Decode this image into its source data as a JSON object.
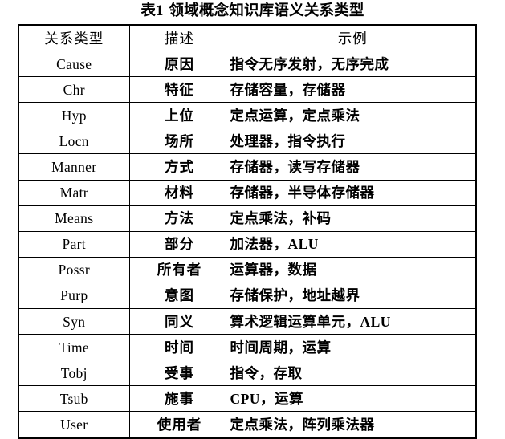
{
  "caption": {
    "label": "表",
    "number": "1",
    "title": "领域概念知识库语义关系类型",
    "full": "表 1  领域概念知识库语义关系类型"
  },
  "table": {
    "columns": [
      {
        "key": "type",
        "header": "关系类型"
      },
      {
        "key": "description",
        "header": "描述"
      },
      {
        "key": "example",
        "header": "示例"
      }
    ],
    "rows": [
      {
        "type": "Cause",
        "description": "原因",
        "example": "指令无序发射，无序完成"
      },
      {
        "type": "Chr",
        "description": "特征",
        "example": "存储容量，存储器"
      },
      {
        "type": "Hyp",
        "description": "上位",
        "example": "定点运算，定点乘法"
      },
      {
        "type": "Locn",
        "description": "场所",
        "example": "处理器，指令执行"
      },
      {
        "type": "Manner",
        "description": "方式",
        "example": "存储器，读写存储器"
      },
      {
        "type": "Matr",
        "description": "材料",
        "example": "存储器，半导体存储器"
      },
      {
        "type": "Means",
        "description": "方法",
        "example": "定点乘法，补码"
      },
      {
        "type": "Part",
        "description": "部分",
        "example": "加法器，ALU"
      },
      {
        "type": "Possr",
        "description": "所有者",
        "example": "运算器，数据"
      },
      {
        "type": "Purp",
        "description": "意图",
        "example": "存储保护，地址越界"
      },
      {
        "type": "Syn",
        "description": "同义",
        "example": "算术逻辑运算单元，ALU"
      },
      {
        "type": "Time",
        "description": "时间",
        "example": "时间周期，运算"
      },
      {
        "type": "Tobj",
        "description": "受事",
        "example": "指令，存取"
      },
      {
        "type": "Tsub",
        "description": "施事",
        "example": "CPU，运算"
      },
      {
        "type": "User",
        "description": "使用者",
        "example": "定点乘法，阵列乘法器"
      }
    ]
  },
  "style": {
    "text_color": "#000000",
    "border_color": "#000000",
    "background": "#ffffff"
  }
}
